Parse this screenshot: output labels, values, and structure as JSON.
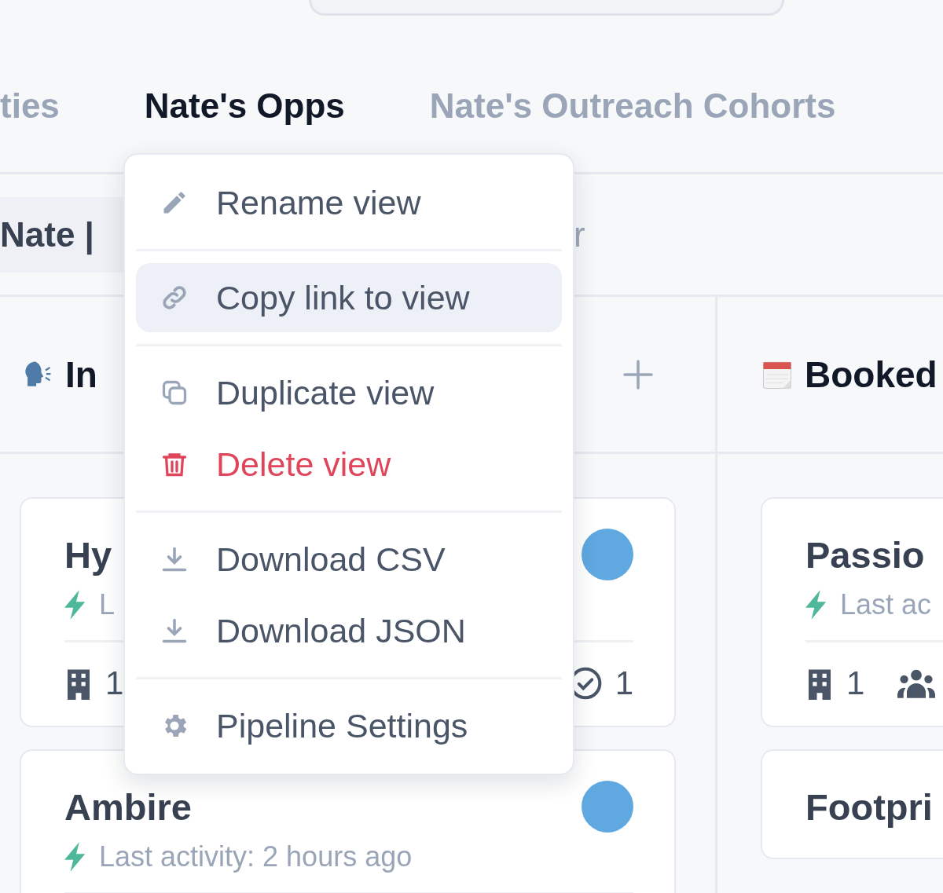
{
  "tabs": [
    {
      "label": "ties",
      "selected": false
    },
    {
      "label": "Nate's Opps",
      "selected": true
    },
    {
      "label": "Nate's Outreach Cohorts",
      "selected": false
    }
  ],
  "filter": {
    "chip": "Nate |",
    "trailing": "r"
  },
  "columns": [
    {
      "title": "In",
      "add_button": true,
      "cards": [
        {
          "title": "Hy",
          "avatar": true,
          "activity": "L",
          "stats": [
            {
              "kind": "companies",
              "count": "1"
            },
            {
              "kind": "tasks",
              "count": "1"
            }
          ]
        },
        {
          "title": "Ambire",
          "avatar": true,
          "activity": "Last activity: 2 hours ago"
        }
      ]
    },
    {
      "title": "Booked",
      "add_button": false,
      "cards": [
        {
          "title": "Passio",
          "avatar": false,
          "activity": "Last ac",
          "stats": [
            {
              "kind": "companies",
              "count": "1"
            },
            {
              "kind": "people"
            }
          ]
        },
        {
          "title": "Footpri",
          "avatar": false
        }
      ]
    }
  ],
  "menu": {
    "groups": [
      [
        {
          "label": "Rename view",
          "kind": "normal",
          "highlighted": false
        }
      ],
      [
        {
          "label": "Copy link to view",
          "kind": "normal",
          "highlighted": true
        }
      ],
      [
        {
          "label": "Duplicate view",
          "kind": "normal",
          "highlighted": false
        },
        {
          "label": "Delete view",
          "kind": "danger",
          "highlighted": false
        }
      ],
      [
        {
          "label": "Download CSV",
          "kind": "normal",
          "highlighted": false
        },
        {
          "label": "Download JSON",
          "kind": "normal",
          "highlighted": false
        }
      ],
      [
        {
          "label": "Pipeline Settings",
          "kind": "normal",
          "highlighted": false
        }
      ]
    ]
  }
}
